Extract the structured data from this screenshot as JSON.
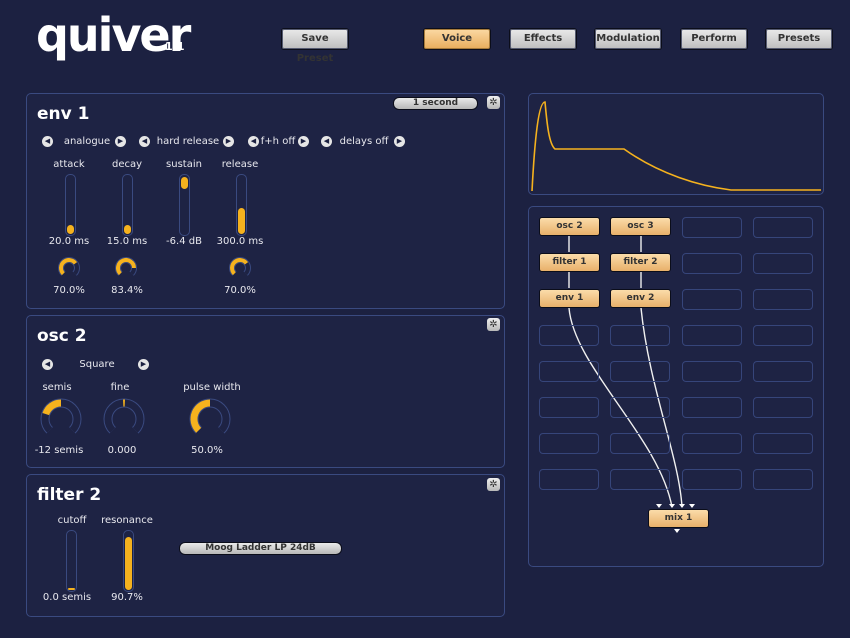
{
  "app": {
    "name": "quiver",
    "version": "1.1"
  },
  "toolbar": {
    "save_preset": "Save Preset",
    "tabs": [
      {
        "label": "Voice",
        "active": true
      },
      {
        "label": "Effects",
        "active": false
      },
      {
        "label": "Modulation",
        "active": false
      },
      {
        "label": "Perform",
        "active": false
      },
      {
        "label": "Presets",
        "active": false
      }
    ]
  },
  "env1": {
    "title": "env 1",
    "time_scale": "1 second",
    "selectors": [
      "analogue",
      "hard release",
      "f+h off",
      "delays off"
    ],
    "sliders": [
      {
        "label": "attack",
        "value": "20.0 ms",
        "level": 0.05,
        "curve": "70.0%",
        "curve_level": 0.7
      },
      {
        "label": "decay",
        "value": "15.0 ms",
        "level": 0.04,
        "curve": "83.4%",
        "curve_level": 0.834
      },
      {
        "label": "sustain",
        "value": "-6.4 dB",
        "level": 0.85,
        "curve": null
      },
      {
        "label": "release",
        "value": "300.0 ms",
        "level": 0.45,
        "curve": "70.0%",
        "curve_level": 0.7
      }
    ]
  },
  "osc2": {
    "title": "osc 2",
    "waveform": "Square",
    "knobs": [
      {
        "label": "semis",
        "value": "-12 semis",
        "level": 0.25
      },
      {
        "label": "fine",
        "value": "0.000",
        "level": 0.5
      },
      {
        "label": "pulse width",
        "value": "50.0%",
        "level": 0.5
      }
    ]
  },
  "filter2": {
    "title": "filter 2",
    "type": "Moog Ladder LP 24dB",
    "sliders": [
      {
        "label": "cutoff",
        "value": "0.0 semis",
        "level": 0.0
      },
      {
        "label": "resonance",
        "value": "90.7%",
        "level": 0.907
      }
    ]
  },
  "routing": {
    "nodes": [
      {
        "label": "osc 2"
      },
      {
        "label": "osc 3"
      },
      {
        "label": "filter 1"
      },
      {
        "label": "filter 2"
      },
      {
        "label": "env 1"
      },
      {
        "label": "env 2"
      },
      {
        "label": "mix 1"
      }
    ]
  },
  "colors": {
    "accent": "#f5b21e",
    "background": "#1c2141",
    "panel_border": "#3a4a80",
    "active_tab": "#f2c27f"
  }
}
